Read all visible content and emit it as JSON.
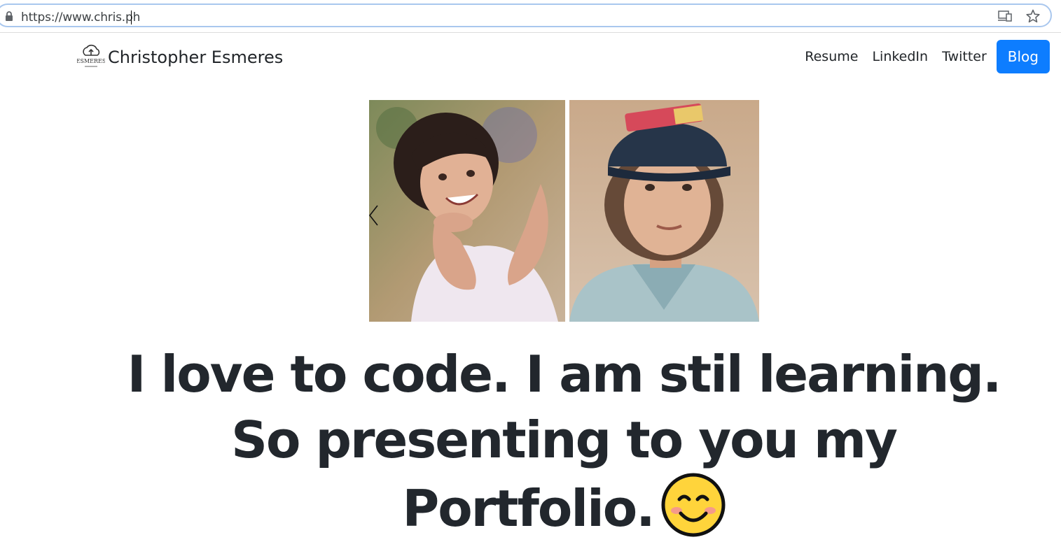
{
  "browser": {
    "url": "https://www.chris.ph"
  },
  "nav": {
    "brand_logo_text": "ESMERES",
    "brand_name": "Christopher Esmeres",
    "links": [
      "Resume",
      "LinkedIn",
      "Twitter"
    ],
    "blog_button": "Blog",
    "blog_color": "#0d7dff"
  },
  "hero": {
    "headline": "I love to code. I am stil learning. So presenting to you my Portfolio.",
    "emoji_icon": "smiling-face-icon"
  },
  "carousel": {
    "prev_icon": "chevron-left-icon"
  }
}
